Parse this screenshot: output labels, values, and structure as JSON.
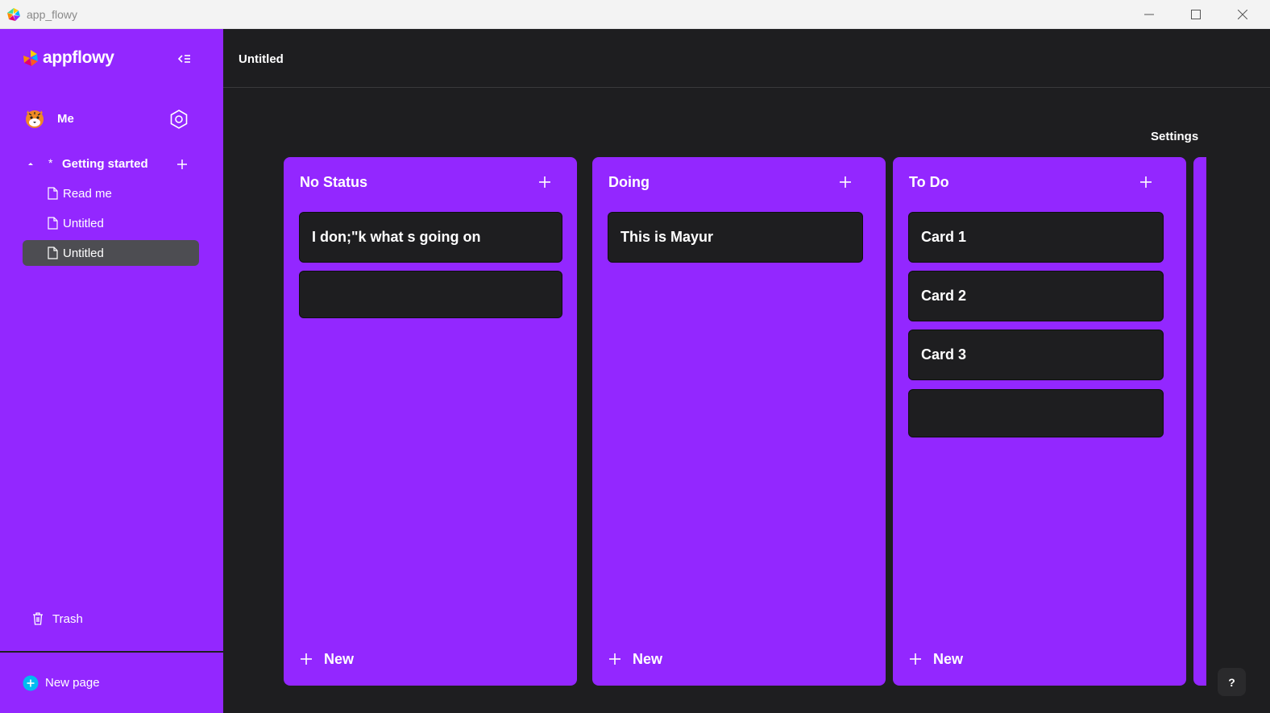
{
  "window": {
    "title": "app_flowy"
  },
  "sidebar": {
    "brand": "appflowy",
    "user": {
      "name": "Me"
    },
    "workspace": {
      "star": "*",
      "label": "Getting started"
    },
    "pages": [
      {
        "label": "Read me",
        "selected": false
      },
      {
        "label": "Untitled",
        "selected": false
      },
      {
        "label": "Untitled",
        "selected": true
      }
    ],
    "trash_label": "Trash",
    "new_page_label": "New page"
  },
  "main": {
    "title": "Untitled",
    "settings_label": "Settings",
    "columns": [
      {
        "title": "No Status",
        "cards": [
          "I don;\"k what s going on",
          ""
        ],
        "new_label": "New"
      },
      {
        "title": "Doing",
        "cards": [
          "This is Mayur"
        ],
        "new_label": "New"
      },
      {
        "title": "To Do",
        "cards": [
          "Card 1",
          "Card 2",
          "Card 3",
          ""
        ],
        "new_label": "New"
      }
    ],
    "help_label": "?"
  },
  "colors": {
    "accent": "#9327ff",
    "background": "#1e1e20",
    "card": "#1e1e20",
    "selected": "#4d4d52",
    "new_page_icon": "#00bcf0"
  }
}
